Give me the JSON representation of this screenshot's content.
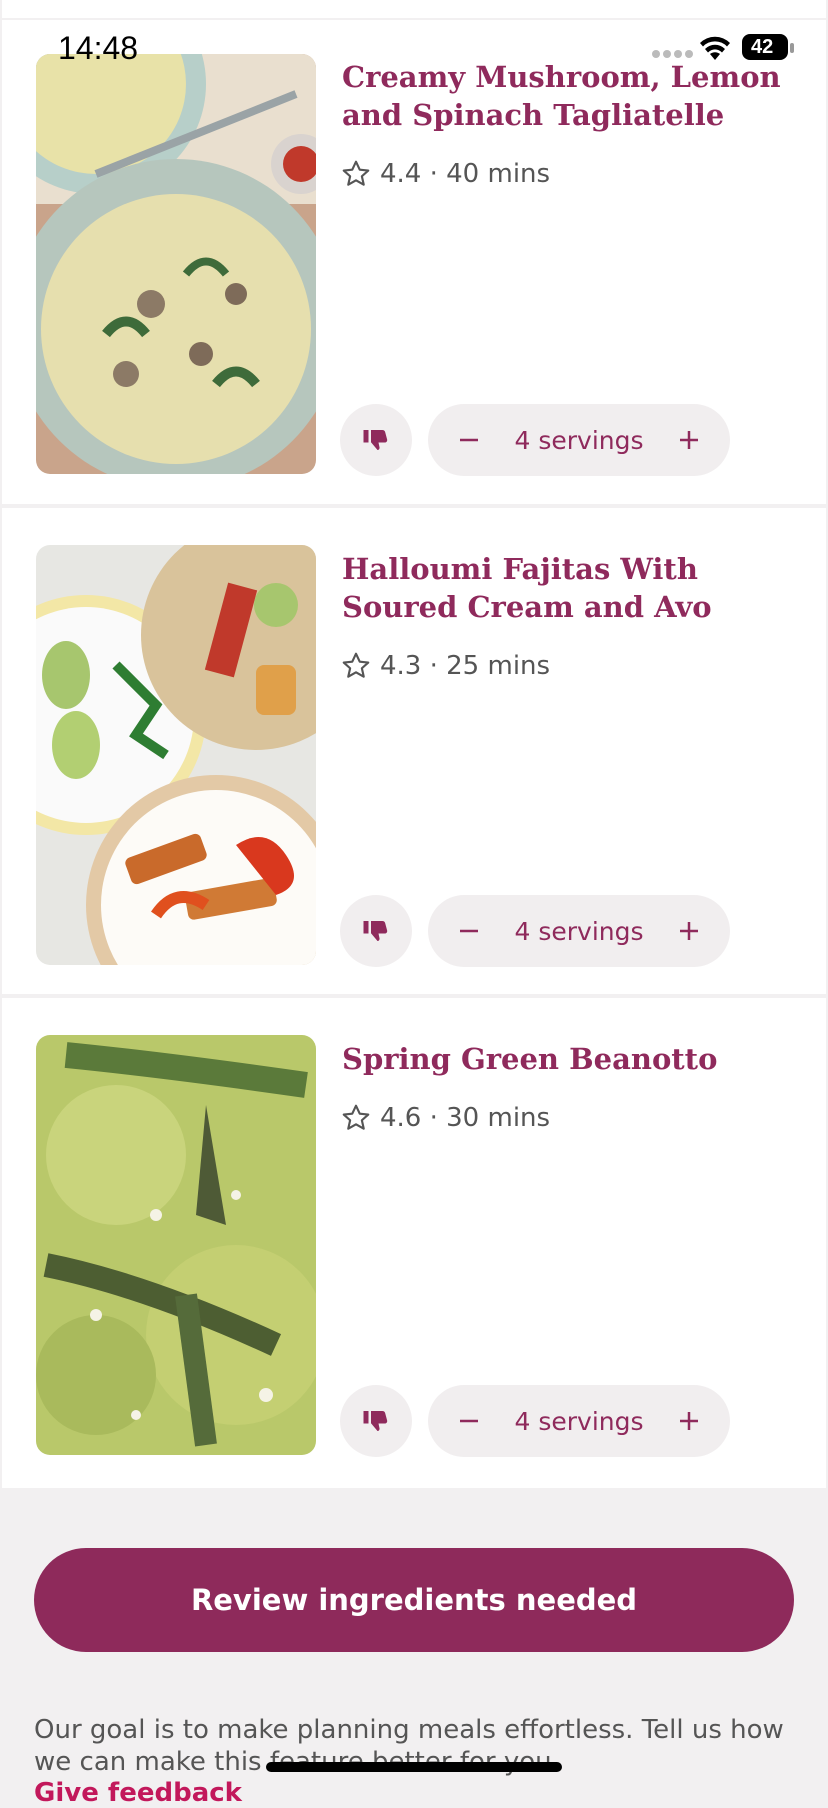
{
  "status_bar": {
    "time": "14:48",
    "battery": "42"
  },
  "recipes": [
    {
      "title": "Creamy Mushroom, Lemon and Spinach Tagliatelle",
      "meta": "4.4 · 40 mins",
      "servings_label": "4 servings",
      "image": "pasta-dish-image"
    },
    {
      "title": "Halloumi Fajitas With Soured Cream and Avo",
      "meta": "4.3 · 25 mins",
      "servings_label": "4 servings",
      "image": "fajitas-dish-image"
    },
    {
      "title": "Spring Green Beanotto",
      "meta": "4.6 · 30 mins",
      "servings_label": "4 servings",
      "image": "beanotto-dish-image"
    }
  ],
  "review_button": "Review ingredients needed",
  "footer": {
    "text": "Our goal is to make planning meals effortless. Tell us how we can make this feature better for you.",
    "link": "Give feedback"
  },
  "colors": {
    "accent": "#8e2a5b",
    "background": "#f2f0f1",
    "pill": "#f1eeef"
  }
}
